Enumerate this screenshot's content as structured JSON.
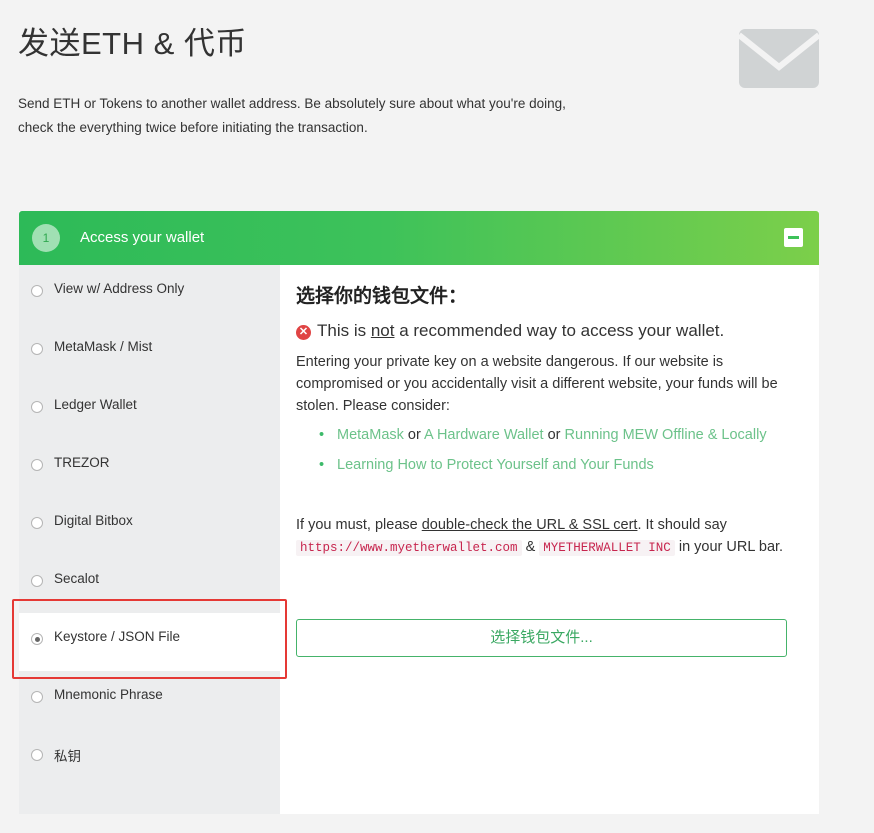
{
  "page": {
    "title": "发送ETH & 代币",
    "intro": "Send ETH or Tokens to another wallet address. Be absolutely sure about what you're doing, check the everything twice before initiating the transaction.",
    "icon": "envelope-icon"
  },
  "panel": {
    "step_number": "1",
    "header_title": "Access your wallet",
    "collapse_icon": "minus-square-icon",
    "accent_color": "#3dc25a"
  },
  "sidebar": {
    "options": [
      {
        "label": "View w/ Address Only",
        "selected": false
      },
      {
        "label": "MetaMask / Mist",
        "selected": false
      },
      {
        "label": "Ledger Wallet",
        "selected": false
      },
      {
        "label": "TREZOR",
        "selected": false
      },
      {
        "label": "Digital Bitbox",
        "selected": false
      },
      {
        "label": "Secalot",
        "selected": false
      },
      {
        "label": "Keystore / JSON File",
        "selected": true
      },
      {
        "label": "Mnemonic Phrase",
        "selected": false
      },
      {
        "label": "私钥",
        "selected": false
      }
    ]
  },
  "content": {
    "heading": "选择你的钱包文件：",
    "warning_pre": "This is ",
    "warning_emph": "not",
    "warning_post": " a recommended way to access your wallet.",
    "warning_icon": "x-circle-icon",
    "paragraph": "Entering your private key on a website dangerous. If our website is compromised or you accidentally visit a different website, your funds will be stolen. Please consider:",
    "link_metamask": "MetaMask",
    "or1": " or ",
    "link_hardware": "A Hardware Wallet",
    "or2": " or ",
    "link_offline": "Running MEW Offline & Locally",
    "link_learning": "Learning How to Protect Yourself and Your Funds",
    "must_pre": "If you must, please ",
    "must_link": "double-check the URL & SSL cert",
    "must_mid": ". It should say ",
    "url_code": "https://www.myetherwallet.com",
    "amp": " & ",
    "name_code": "MYETHERWALLET INC",
    "must_post": " in your URL bar.",
    "file_button": "选择钱包文件..."
  }
}
